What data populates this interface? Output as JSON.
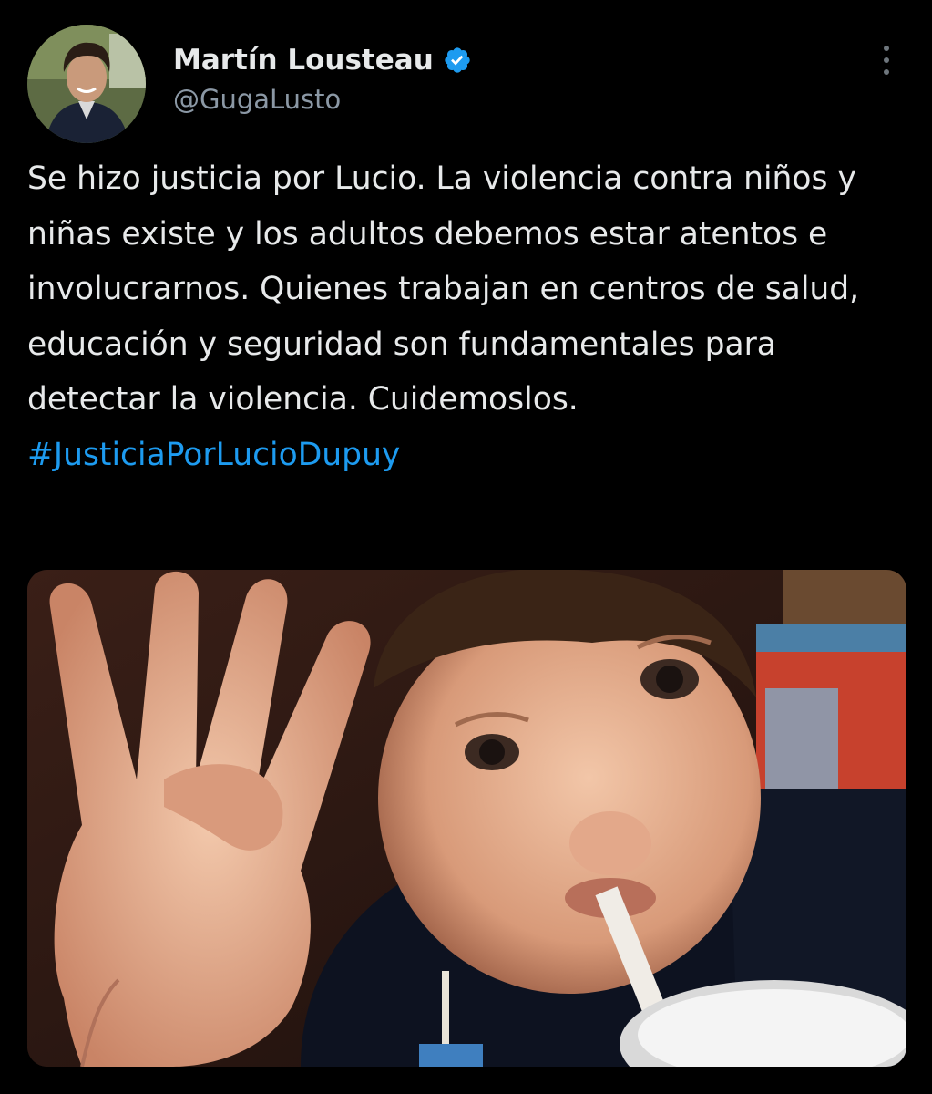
{
  "author": {
    "name": "Martín Lousteau",
    "handle": "@GugaLusto",
    "verified_icon": "verified-badge-icon",
    "verified_color": "#1d9bf0"
  },
  "tweet": {
    "body": "Se hizo justicia por Lucio. La violencia contra niños y niñas existe y los adultos debemos estar atentos e involucrarnos. Quienes trabajan en centros de salud, educación y seguridad son fundamentales para detectar la violencia. Cuidemoslos.",
    "hashtag": "#JusticiaPorLucioDupuy",
    "hashtag_color": "#1d9bf0"
  },
  "menu": {
    "icon": "more-options-icon"
  },
  "media": {
    "type": "photo"
  },
  "colors": {
    "background": "#000000",
    "text": "#e7e9ea",
    "secondary_text": "#8b98a5"
  }
}
